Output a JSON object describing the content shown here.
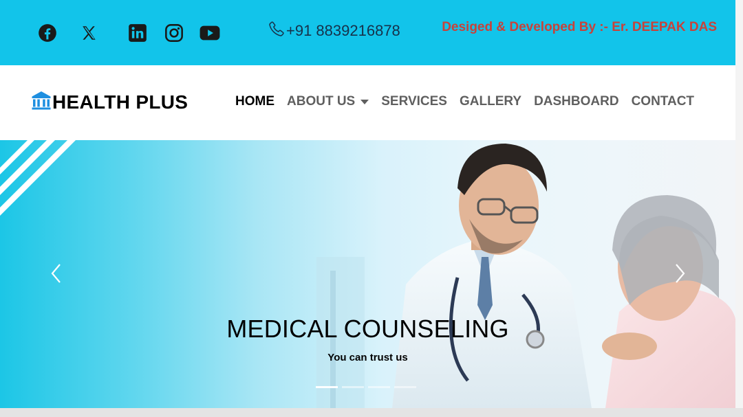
{
  "topbar": {
    "social": [
      {
        "name": "facebook-icon"
      },
      {
        "name": "x-twitter-icon"
      },
      {
        "name": "linkedin-icon"
      },
      {
        "name": "instagram-icon"
      },
      {
        "name": "youtube-icon"
      }
    ],
    "phone": "+91 8839216878",
    "credit": "Desiged & Developed By :- Er. DEEPAK DAS"
  },
  "navbar": {
    "brand": "HEALTH PLUS",
    "brand_icon": "bank-building-icon",
    "items": [
      {
        "label": "HOME",
        "active": true
      },
      {
        "label": "ABOUT US",
        "dropdown": true
      },
      {
        "label": "SERVICES"
      },
      {
        "label": "GALLERY"
      },
      {
        "label": "DASHBOARD"
      },
      {
        "label": "CONTACT"
      }
    ]
  },
  "hero": {
    "title": "MEDICAL COUNSELING",
    "subtitle": "You can trust us",
    "slides": 4,
    "active_slide": 1
  },
  "colors": {
    "topbar_bg": "#12c4ea",
    "credit": "#c8423a",
    "brand_icon": "#1e8fe0"
  }
}
